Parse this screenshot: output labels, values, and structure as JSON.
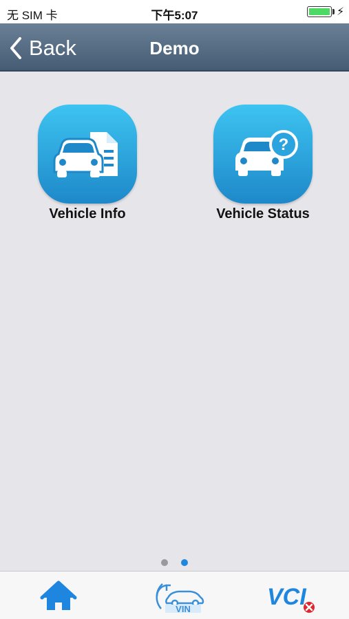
{
  "status_bar": {
    "carrier": "无 SIM 卡",
    "time": "下午5:07",
    "battery_level": 1.0
  },
  "nav": {
    "back_label": "Back",
    "title": "Demo"
  },
  "apps": [
    {
      "label": "Vehicle Info",
      "icon": "car-document-icon"
    },
    {
      "label": "Vehicle Status",
      "icon": "car-question-icon"
    }
  ],
  "pager": {
    "page_count": 2,
    "current_page": 2
  },
  "tab_bar": {
    "items": [
      {
        "icon": "home-icon"
      },
      {
        "icon": "vin-scan-icon",
        "text": "VIN"
      },
      {
        "icon": "vci-disconnected-icon",
        "text": "VCI"
      }
    ]
  },
  "colors": {
    "nav_bar": "#465c74",
    "icon_gradient_top": "#3dc4f1",
    "icon_gradient_bottom": "#1e88c9",
    "tab_blue": "#1f86e0",
    "error_red": "#e3262e",
    "battery_green": "#4cd964"
  }
}
